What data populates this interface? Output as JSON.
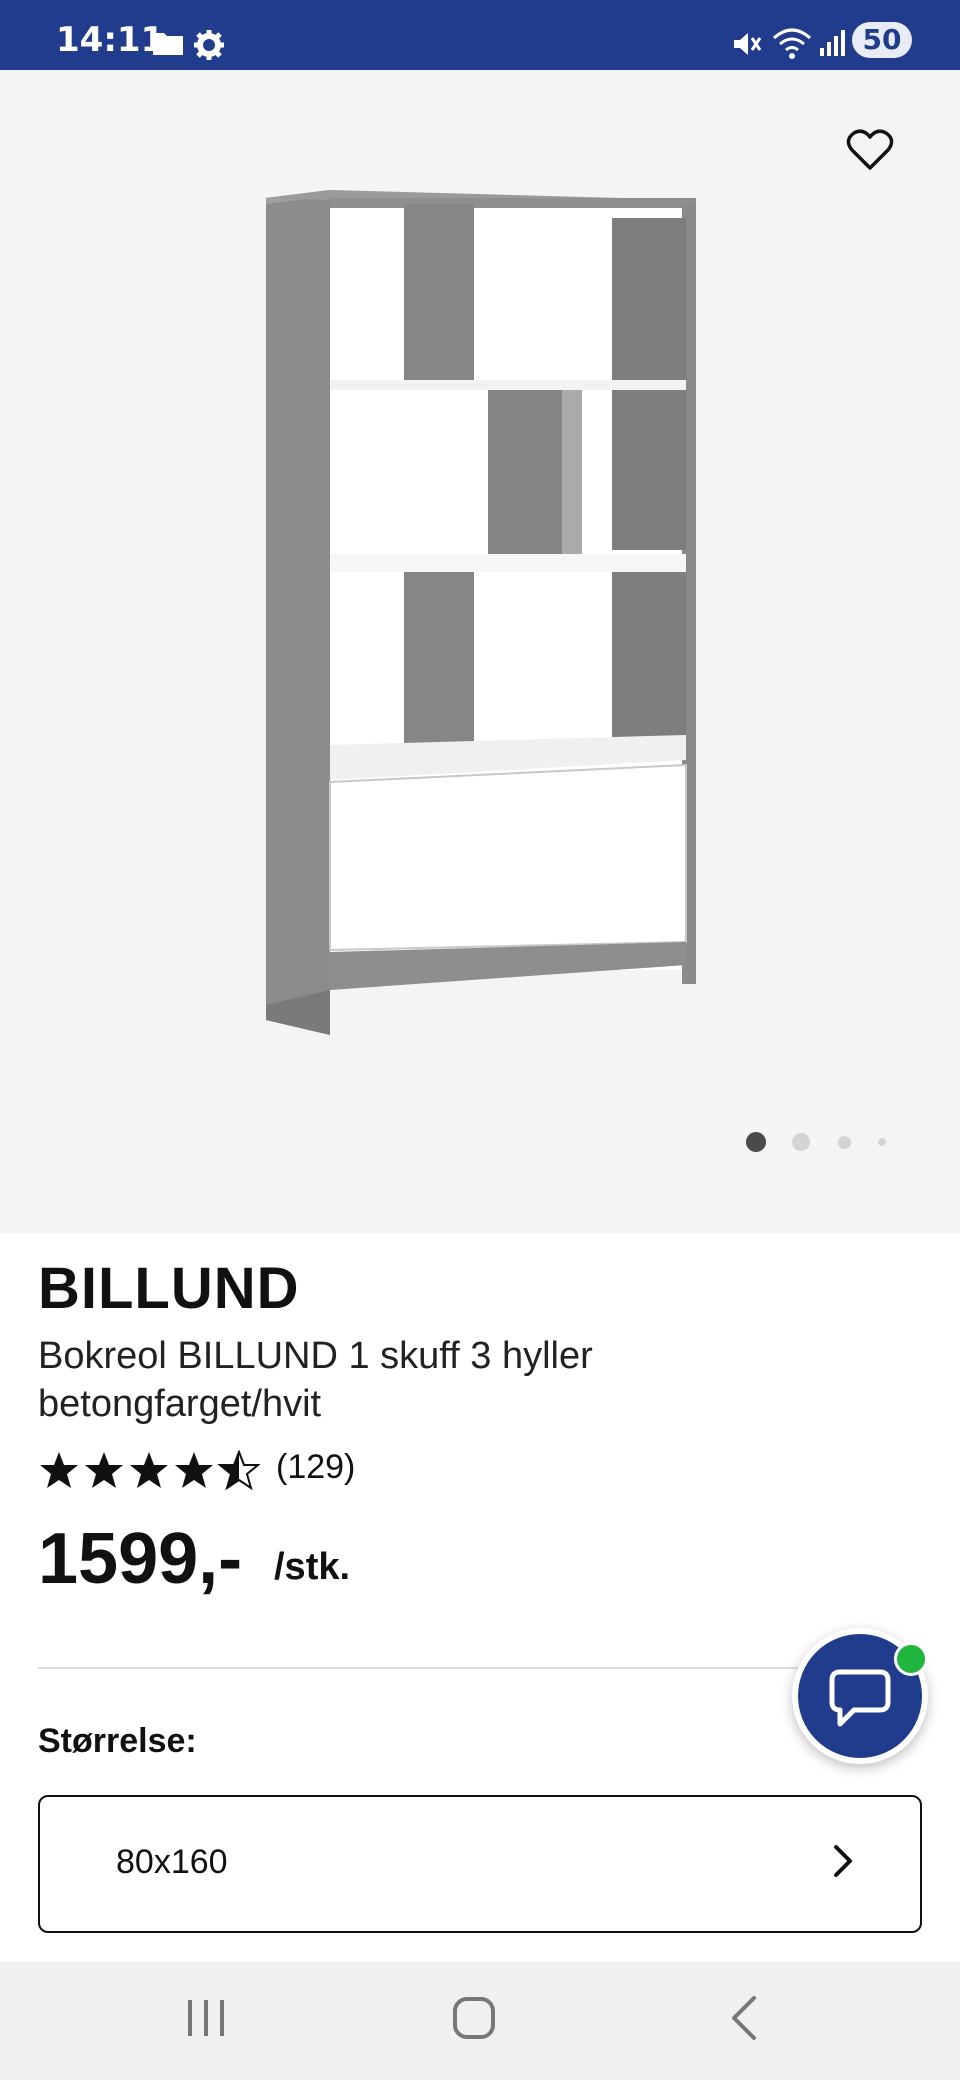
{
  "status_bar": {
    "time": "14:11",
    "battery": "50",
    "icons": [
      "folder-icon",
      "gear-icon",
      "mute-icon",
      "wifi-icon",
      "signal-icon"
    ]
  },
  "product": {
    "brand": "BILLUND",
    "description": "Bokreol BILLUND 1 skuff 3 hyller betongfarget/hvit",
    "rating_value": 4.5,
    "rating_count": "(129)",
    "price": "1599,-",
    "unit": "/stk.",
    "image_count": 4,
    "current_image": 1
  },
  "size": {
    "label": "Størrelse:",
    "value": "80x160"
  },
  "colors": {
    "brand_blue": "#213c8c",
    "online_green": "#1fb53f",
    "background_grey": "#f4f4f4"
  },
  "nav_icons": [
    "recent-apps-icon",
    "home-icon",
    "back-icon"
  ]
}
